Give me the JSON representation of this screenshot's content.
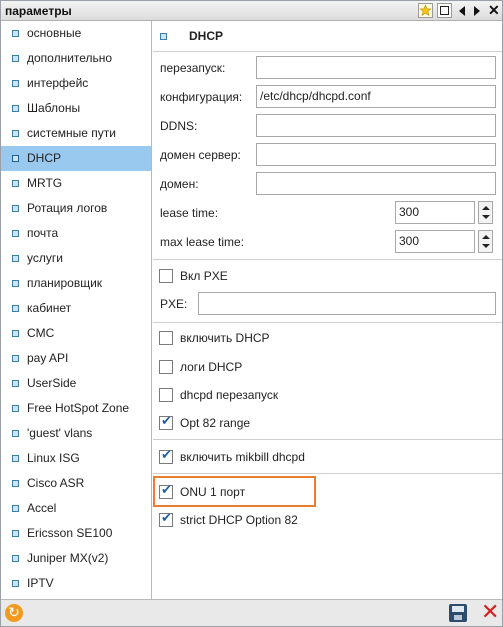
{
  "window": {
    "title": "параметры",
    "close_glyph": "✕"
  },
  "sidebar": {
    "items": [
      {
        "label": "основные",
        "active": false
      },
      {
        "label": "дополнительно",
        "active": false
      },
      {
        "label": "интерфейс",
        "active": false
      },
      {
        "label": "Шаблоны",
        "active": false
      },
      {
        "label": "системные пути",
        "active": false
      },
      {
        "label": "DHCP",
        "active": true
      },
      {
        "label": "MRTG",
        "active": false
      },
      {
        "label": "Ротация логов",
        "active": false
      },
      {
        "label": "почта",
        "active": false
      },
      {
        "label": "услуги",
        "active": false
      },
      {
        "label": "планировщик",
        "active": false
      },
      {
        "label": "кабинет",
        "active": false
      },
      {
        "label": "CMC",
        "active": false
      },
      {
        "label": "pay API",
        "active": false
      },
      {
        "label": "UserSide",
        "active": false
      },
      {
        "label": "Free HotSpot Zone",
        "active": false
      },
      {
        "label": "'guest' vlans",
        "active": false
      },
      {
        "label": "Linux ISG",
        "active": false
      },
      {
        "label": "Cisco ASR",
        "active": false
      },
      {
        "label": "Accel",
        "active": false
      },
      {
        "label": "Ericsson SE100",
        "active": false
      },
      {
        "label": "Juniper MX(v2)",
        "active": false
      },
      {
        "label": "IPTV",
        "active": false
      }
    ]
  },
  "dhcp": {
    "section_title": "DHCP",
    "restart_label": "перезапуск:",
    "restart_value": "",
    "config_label": "конфигурация:",
    "config_value": "/etc/dhcp/dhcpd.conf",
    "ddns_label": "DDNS:",
    "ddns_value": "",
    "domain_server_label": "домен сервер:",
    "domain_server_value": "",
    "domain_label": "домен:",
    "domain_value": "",
    "lease_time_label": "lease time:",
    "lease_time_value": "300",
    "max_lease_time_label": "max lease time:",
    "max_lease_time_value": "300",
    "pxe_enable_label": "Вкл PXE",
    "pxe_enable_checked": false,
    "pxe_label": "PXE:",
    "pxe_value": "",
    "enable_dhcp_label": "включить DHCP",
    "enable_dhcp_checked": false,
    "dhcp_logs_label": "логи DHCP",
    "dhcp_logs_checked": false,
    "dhcpd_restart_label": "dhcpd перезапуск",
    "dhcpd_restart_checked": false,
    "opt82_label": "Opt 82 range",
    "opt82_checked": true,
    "mikbill_dhcpd_label": "включить mikbill dhcpd",
    "mikbill_dhcpd_checked": true,
    "onu_port_label": "ONU 1 порт",
    "onu_port_checked": true,
    "strict_opt82_label": "strict DHCP Option 82",
    "strict_opt82_checked": true
  },
  "icons": {
    "favorite": "star-icon",
    "maximize": "window-icon",
    "prev": "arrow-left-icon",
    "next": "arrow-right-icon",
    "close": "close-icon",
    "refresh": "refresh-icon",
    "save": "floppy-disk-icon",
    "cancel": "red-x-icon"
  },
  "colors": {
    "active_item": "#99c9ef",
    "highlight_border": "#e77f2f",
    "checkmark": "#1f5fa8",
    "cancel": "#d62020"
  }
}
